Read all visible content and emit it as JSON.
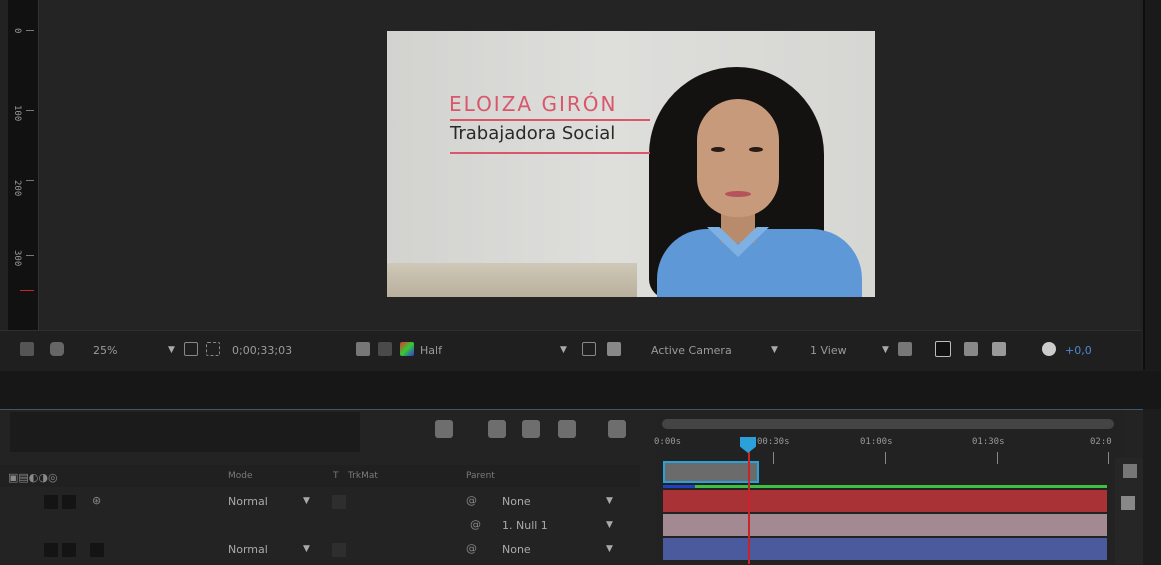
{
  "viewer": {
    "ruler_labels": [
      "0",
      "100",
      "200",
      "300"
    ],
    "composition": {
      "name_title": "ELOIZA GIRÓN",
      "name_subtitle": "Trabajadora Social",
      "accent_color": "#d9566b"
    }
  },
  "viewer_toolbar": {
    "zoom": "25%",
    "timecode": "0;00;33;03",
    "resolution": "Half",
    "camera": "Active Camera",
    "views": "1 View",
    "exposure": "+0,0"
  },
  "timeline": {
    "columns": {
      "mode": "Mode",
      "t": "T",
      "trkmat": "TrkMat",
      "parent": "Parent"
    },
    "ruler_times": [
      "0:00s",
      "00:30s",
      "01:00s",
      "01:30s",
      "02:0"
    ],
    "rows": [
      {
        "mode": "Normal",
        "parent": "None"
      },
      {
        "mode": "",
        "parent": "1. Null 1"
      },
      {
        "mode": "Normal",
        "parent": "None"
      }
    ],
    "layer_colors": [
      "#a83236",
      "#a38a92",
      "#4a5a9c"
    ],
    "playhead_color": "#c8242a",
    "workarea_color": "#2ca0d8"
  }
}
